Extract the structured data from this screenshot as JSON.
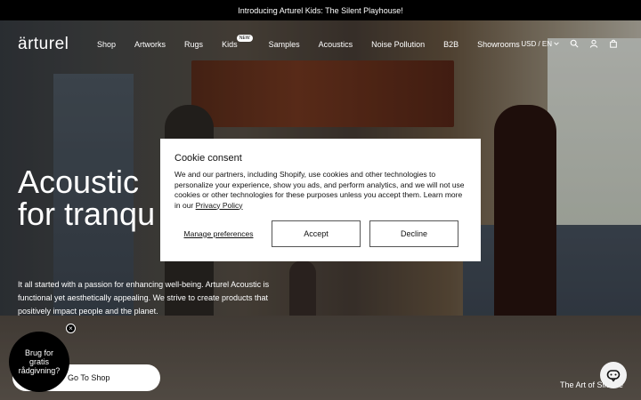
{
  "announcement": "Introducing Arturel Kids: The Silent Playhouse!",
  "logo": "ärturel",
  "nav": [
    {
      "label": "Shop"
    },
    {
      "label": "Artworks"
    },
    {
      "label": "Rugs"
    },
    {
      "label": "Kids",
      "badge": "NEW"
    },
    {
      "label": "Samples"
    },
    {
      "label": "Acoustics"
    },
    {
      "label": "Noise Pollution"
    },
    {
      "label": "B2B"
    },
    {
      "label": "Showrooms"
    }
  ],
  "utility": {
    "currency": "USD / EN",
    "icons": [
      "search-icon",
      "account-icon",
      "cart-icon"
    ]
  },
  "hero": {
    "title_line1": "Acoustic",
    "title_line2": "for tranqu",
    "text": "It all started with a passion for enhancing well-being. Arturel Acoustic is functional yet aesthetically appealing. We strive to create products that positively impact people and the planet.",
    "shop_button": "Go To Shop",
    "art_link": "The Art of Silence"
  },
  "chat_bubble": {
    "text": "Brug for gratis rådgivning?",
    "close": "×"
  },
  "cookie": {
    "title": "Cookie consent",
    "body": "We and our partners, including Shopify, use cookies and other technologies to personalize your experience, show you ads, and perform analytics, and we will not use cookies or other technologies for these purposes unless you accept them. Learn more in our ",
    "link": "Privacy Policy",
    "manage": "Manage preferences",
    "accept": "Accept",
    "decline": "Decline"
  }
}
